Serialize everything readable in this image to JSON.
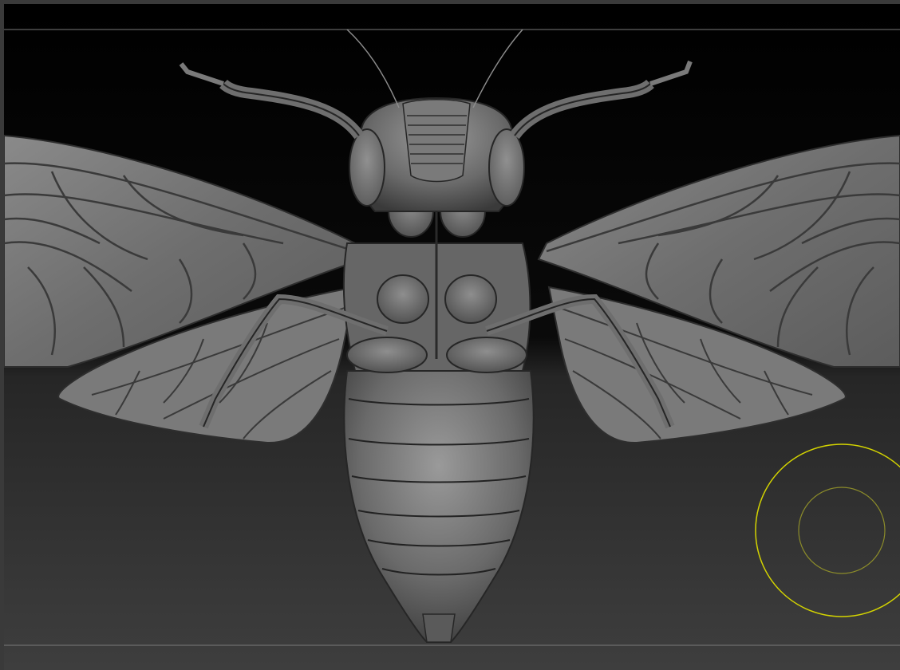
{
  "viewport": {
    "background_top": "#000000",
    "background_bottom": "#3d3d3d",
    "guide_line_color": "#8a8a8a"
  },
  "model": {
    "subject": "cicada",
    "material": "gray-clay",
    "base_color": "#777777",
    "shadow_color": "#2a2a2a",
    "highlight_color": "#b8b8b8"
  },
  "brush_cursor": {
    "color": "#d4d400",
    "inner_color": "#8c8c2a"
  }
}
